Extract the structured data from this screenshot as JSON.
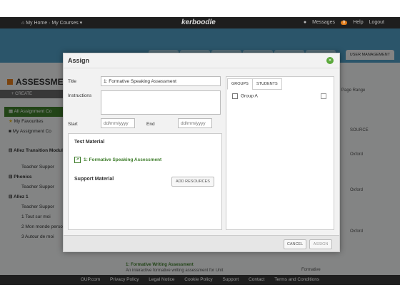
{
  "topbar": {
    "home": "My Home",
    "courses": "My Courses",
    "brand": "kerboodle",
    "messages": "Messages",
    "messages_count": "0",
    "help": "Help",
    "logout": "Logout"
  },
  "header": {
    "user_management": "USER MANAGEMENT"
  },
  "page": {
    "title": "ASSESSMEN",
    "create": "CREATE",
    "sidebar": [
      "All Assignment Co",
      "My Favourites",
      "My Assignment Co",
      "Allez Transition Module",
      "Teacher Suppor",
      "Phonics",
      "Teacher Suppor",
      "Allez 1",
      "Teacher Suppor",
      "1 Tout sur moi",
      "2 Mon monde perso",
      "3 Autour de moi"
    ],
    "right": {
      "page_range": "Page Range",
      "source_header": "SOURCE",
      "source_1": "Oxford",
      "source_2": "Oxford",
      "source_3": "Oxford",
      "formative": "Formative"
    },
    "bottom_row": {
      "title": "1: Formative Writing Assessment",
      "desc": "An interactive formative writing assessment for Unit"
    }
  },
  "footer": {
    "links": [
      "OUP.com",
      "Privacy Policy",
      "Legal Notice",
      "Cookie Policy",
      "Support",
      "Contact",
      "Terms and Conditions"
    ]
  },
  "dialog": {
    "title": "Assign",
    "title_label": "Title",
    "title_value": "1: Formative Speaking Assessment",
    "instructions_label": "Instructions",
    "start_label": "Start",
    "end_label": "End",
    "date_placeholder": "dd/mm/yyyy",
    "test_material": "Test Material",
    "test_item": "1: Formative Speaking Assessment",
    "support_material": "Support Material",
    "add_resources": "ADD RESOURCES",
    "groups_tab": "GROUPS",
    "students_tab": "STUDENTS",
    "group_a": "Group A",
    "cancel": "CANCEL",
    "assign": "ASSIGN"
  },
  "colors": {
    "accent_green": "#3e7d2b",
    "header_blue": "#4f9bc2",
    "orange": "#e07b1a"
  }
}
